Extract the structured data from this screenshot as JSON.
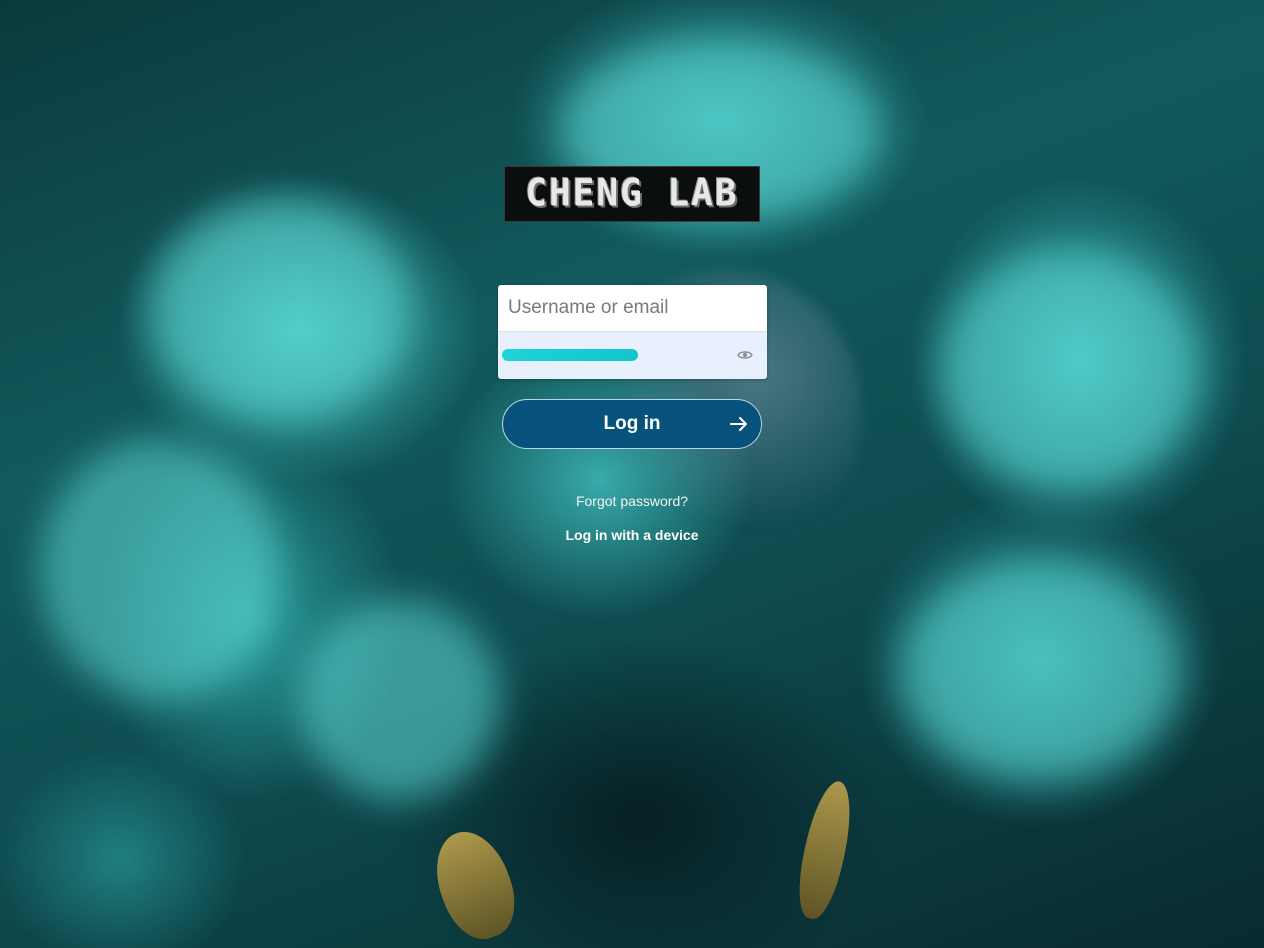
{
  "logo": {
    "text": "CHENG LAB"
  },
  "login_form": {
    "username_placeholder": "Username or email",
    "username_value": "",
    "password_value_masked": true,
    "show_password_icon": "eye-icon"
  },
  "login_button": {
    "label": "Log in",
    "icon": "arrow-right-icon"
  },
  "links": {
    "forgot_password": "Forgot password?",
    "device_login": "Log in with a device"
  },
  "colors": {
    "button_bg": "#07527a",
    "password_field_bg": "#e8f0fe",
    "background_accent": "#48c8c4"
  }
}
